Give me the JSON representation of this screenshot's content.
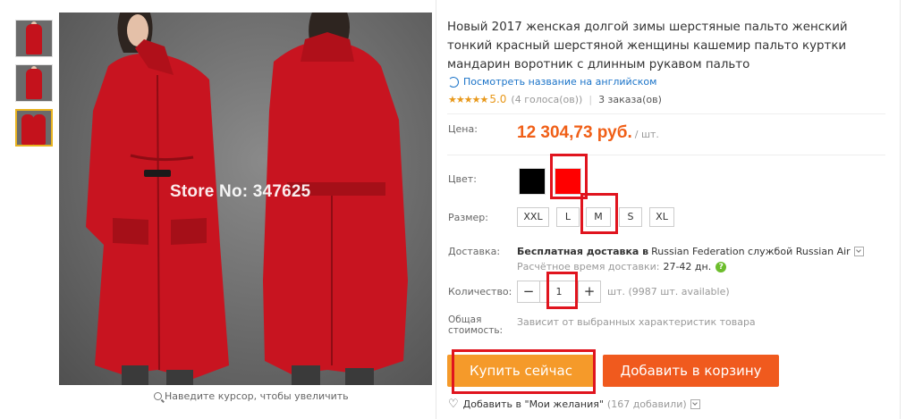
{
  "product": {
    "title": "Новый 2017 женская долгой зимы шерстяные пальто женский тонкий красный шерстяной женщины кашемир пальто куртки мандарин воротник с длинным рукавом пальто",
    "translate_link": "Посмотреть название на английском",
    "rating_stars": "★★★★★",
    "rating_value": "5.0",
    "votes": "(4 голоса(ов))",
    "orders": "3 заказа(ов)",
    "price_label": "Цена:",
    "price": "12 304,73 руб.",
    "price_unit": "/ шт."
  },
  "gallery": {
    "watermark": "Store No: 347625",
    "zoom_hint": "Наведите курсор, чтобы увеличить",
    "thumbnails": [
      "thumb-1",
      "thumb-2",
      "thumb-3"
    ],
    "active_thumbnail": 3
  },
  "options": {
    "color_label": "Цвет:",
    "colors": [
      {
        "name": "black",
        "hex": "#000000"
      },
      {
        "name": "red",
        "hex": "#ff0000"
      }
    ],
    "size_label": "Размер:",
    "sizes": [
      "XXL",
      "L",
      "M",
      "S",
      "XL"
    ]
  },
  "shipping": {
    "label": "Доставка:",
    "free_text": "Бесплатная доставка в",
    "destination": "Russian Federation службой Russian Air",
    "time_label": "Расчётное время доставки:",
    "time_value": "27-42 дн.",
    "help_icon": "?"
  },
  "quantity": {
    "label": "Количество:",
    "minus": "−",
    "value": "1",
    "plus": "+",
    "available": "шт. (9987 шт. available)"
  },
  "total": {
    "label_line1": "Общая",
    "label_line2": "стоимость:",
    "value": "Зависит от выбранных характеристик товара"
  },
  "actions": {
    "buy_now": "Купить сейчас",
    "add_to_cart": "Добавить в корзину",
    "wishlist": "Добавить в \"Мои желания\"",
    "wishlist_count": "(167 добавили)"
  },
  "colors": {
    "price": "#f05f17",
    "buy_button": "#f59a2a",
    "cart_button": "#f05a1e",
    "highlight": "#e0141e",
    "link": "#1a73c8"
  }
}
